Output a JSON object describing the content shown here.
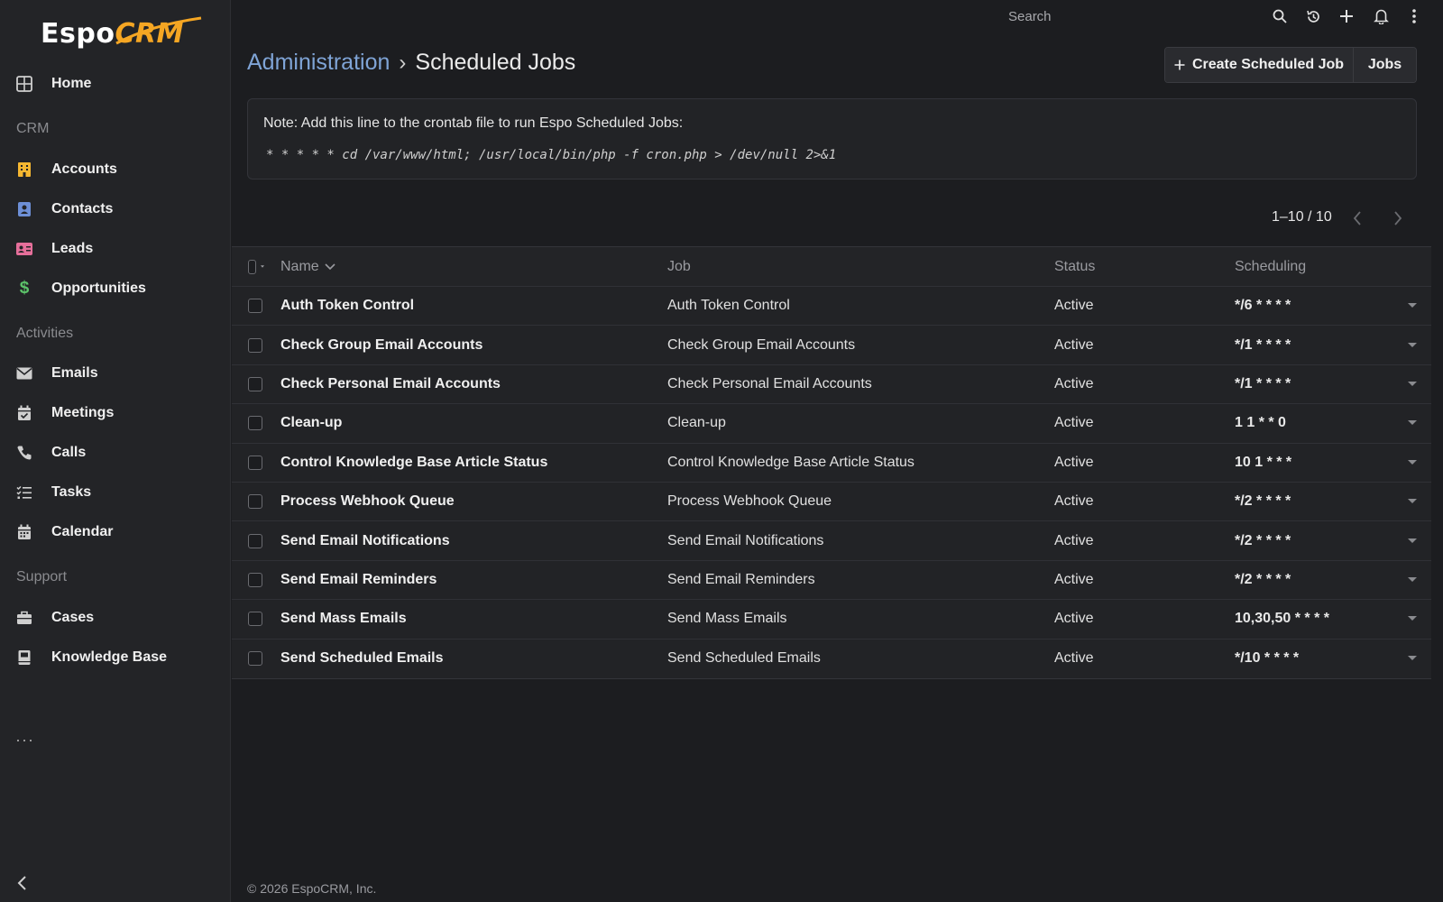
{
  "app": {
    "logo_espo": "Espo",
    "logo_crm": "CRM"
  },
  "sidebar": {
    "home": "Home",
    "groups": {
      "crm": "CRM",
      "activities": "Activities",
      "support": "Support"
    },
    "items": [
      {
        "label": "Accounts",
        "icon": "building-icon"
      },
      {
        "label": "Contacts",
        "icon": "contact-card-icon"
      },
      {
        "label": "Leads",
        "icon": "id-card-icon"
      },
      {
        "label": "Opportunities",
        "icon": "dollar-icon"
      },
      {
        "label": "Emails",
        "icon": "envelope-icon"
      },
      {
        "label": "Meetings",
        "icon": "calendar-check-icon"
      },
      {
        "label": "Calls",
        "icon": "phone-icon"
      },
      {
        "label": "Tasks",
        "icon": "tasks-list-icon"
      },
      {
        "label": "Calendar",
        "icon": "calendar-icon"
      },
      {
        "label": "Cases",
        "icon": "briefcase-icon"
      },
      {
        "label": "Knowledge Base",
        "icon": "book-icon"
      }
    ],
    "more": "···"
  },
  "topbar": {
    "search_placeholder": "Search"
  },
  "header": {
    "breadcrumb_parent": "Administration",
    "breadcrumb_sep": "›",
    "title": "Scheduled Jobs",
    "create_label": "Create Scheduled Job",
    "jobs_label": "Jobs"
  },
  "note": {
    "text": "Note: Add this line to the crontab file to run Espo Scheduled Jobs:",
    "command": "* * * * * cd /var/www/html; /usr/local/bin/php -f cron.php > /dev/null 2>&1"
  },
  "pagination": {
    "text": "1–10 / 10"
  },
  "table": {
    "columns": {
      "name": "Name",
      "job": "Job",
      "status": "Status",
      "scheduling": "Scheduling"
    },
    "rows": [
      {
        "name": "Auth Token Control",
        "job": "Auth Token Control",
        "status": "Active",
        "scheduling": "*/6 * * * *"
      },
      {
        "name": "Check Group Email Accounts",
        "job": "Check Group Email Accounts",
        "status": "Active",
        "scheduling": "*/1 * * * *"
      },
      {
        "name": "Check Personal Email Accounts",
        "job": "Check Personal Email Accounts",
        "status": "Active",
        "scheduling": "*/1 * * * *"
      },
      {
        "name": "Clean-up",
        "job": "Clean-up",
        "status": "Active",
        "scheduling": "1 1 * * 0"
      },
      {
        "name": "Control Knowledge Base Article Status",
        "job": "Control Knowledge Base Article Status",
        "status": "Active",
        "scheduling": "10 1 * * *"
      },
      {
        "name": "Process Webhook Queue",
        "job": "Process Webhook Queue",
        "status": "Active",
        "scheduling": "*/2 * * * *"
      },
      {
        "name": "Send Email Notifications",
        "job": "Send Email Notifications",
        "status": "Active",
        "scheduling": "*/2 * * * *"
      },
      {
        "name": "Send Email Reminders",
        "job": "Send Email Reminders",
        "status": "Active",
        "scheduling": "*/2 * * * *"
      },
      {
        "name": "Send Mass Emails",
        "job": "Send Mass Emails",
        "status": "Active",
        "scheduling": "10,30,50 * * * *"
      },
      {
        "name": "Send Scheduled Emails",
        "job": "Send Scheduled Emails",
        "status": "Active",
        "scheduling": "*/10 * * * *"
      }
    ]
  },
  "footer": {
    "text": "© 2026 EspoCRM, Inc."
  },
  "colors": {
    "background": "#1c1d20",
    "sidebar": "#232427",
    "link": "#7fa4d6",
    "accounts": "#f5b731",
    "contacts": "#6d8fd6",
    "leads": "#e56f9a",
    "opportunities": "#5cc36a",
    "logo_accent": "#f5a623"
  }
}
